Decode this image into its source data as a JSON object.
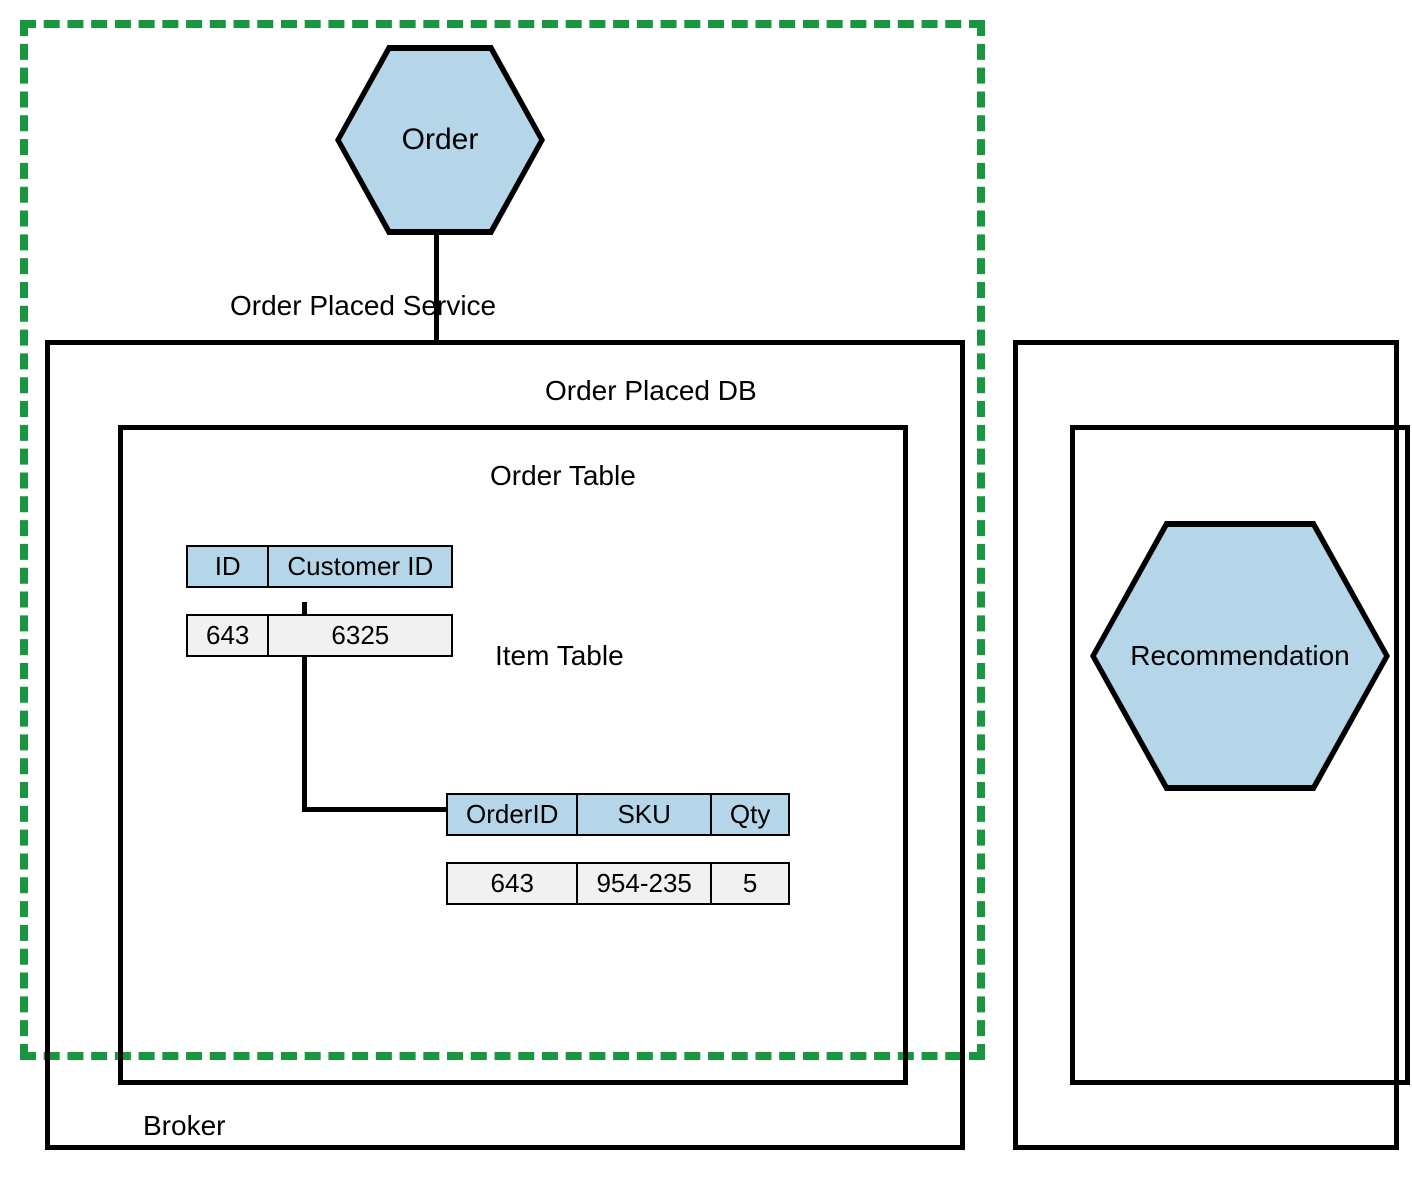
{
  "hex": {
    "order": "Order",
    "recommendation": "Recommendation"
  },
  "labels": {
    "order_placed": "Order Placed Service",
    "order_db": "Order Placed DB",
    "order_table": "Order Table",
    "item_table": "Item Table",
    "broker": "Broker"
  },
  "order_table": {
    "headers": [
      "ID",
      "Customer ID"
    ],
    "row": [
      "643",
      "6325"
    ]
  },
  "item_table": {
    "headers": [
      "OrderID",
      "SKU",
      "Qty"
    ],
    "row": [
      "643",
      "954-235",
      "5"
    ]
  }
}
